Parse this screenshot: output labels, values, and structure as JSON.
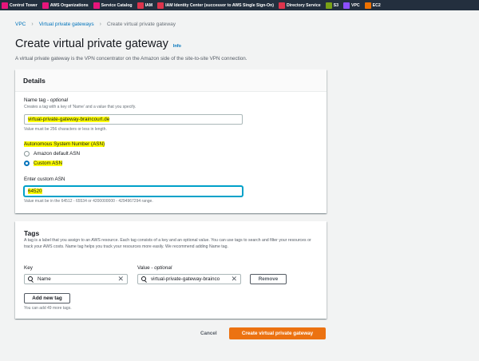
{
  "favorites": [
    {
      "label": "Control Tower",
      "color": "#e7157b",
      "icon": "control-tower-icon"
    },
    {
      "label": "AWS Organizations",
      "color": "#e7157b",
      "icon": "organizations-icon"
    },
    {
      "label": "Service Catalog",
      "color": "#e7157b",
      "icon": "service-catalog-icon"
    },
    {
      "label": "IAM",
      "color": "#dd344c",
      "icon": "iam-icon"
    },
    {
      "label": "IAM Identity Center (successor to AWS Single Sign-On)",
      "color": "#dd344c",
      "icon": "identity-center-icon"
    },
    {
      "label": "Directory Service",
      "color": "#dd344c",
      "icon": "directory-service-icon"
    },
    {
      "label": "S3",
      "color": "#7aa116",
      "icon": "s3-icon"
    },
    {
      "label": "VPC",
      "color": "#8c4fff",
      "icon": "vpc-icon"
    },
    {
      "label": "EC2",
      "color": "#ed7100",
      "icon": "ec2-icon"
    }
  ],
  "breadcrumb": {
    "vpc": "VPC",
    "vgw": "Virtual private gateways",
    "current": "Create virtual private gateway"
  },
  "page": {
    "title": "Create virtual private gateway",
    "info": "Info",
    "description": "A virtual private gateway is the VPN concentrator on the Amazon side of the site-to-site VPN connection."
  },
  "details": {
    "header": "Details",
    "name_tag_label": "Name tag - ",
    "name_tag_optional": "optional",
    "name_tag_hint": "Creates a tag with a key of 'Name' and a value that you specify.",
    "name_tag_value": "virtual-private-gateway-braincourt.de",
    "name_tag_constraint": "Value must be 256 characters or less in length.",
    "asn_label": "Autonomous System Number (ASN)",
    "asn_options": [
      "Amazon default ASN",
      "Custom ASN"
    ],
    "asn_selected": "Custom ASN",
    "custom_asn_label": "Enter custom ASN",
    "custom_asn_value": "64520",
    "custom_asn_constraint": "Value must be in the 64512 - 65534 or 4200000000 - 4294967294 range."
  },
  "tags": {
    "header": "Tags",
    "description": "A tag is a label that you assign to an AWS resource. Each tag consists of a key and an optional value. You can use tags to search and filter your resources or track your AWS costs. Name tag helps you track your resources more easily. We recommend adding Name tag.",
    "key_label": "Key",
    "value_label": "Value - ",
    "value_optional": "optional",
    "key_value": "Name",
    "value_value": "virtual-private-gateway-brainco",
    "remove_label": "Remove",
    "add_label": "Add new tag",
    "remaining": "You can add 49 more tags."
  },
  "footer": {
    "cancel": "Cancel",
    "submit": "Create virtual private gateway"
  },
  "colors": {
    "highlight": "#ffff00",
    "primary": "#ec7211",
    "link": "#0073bb",
    "topbar": "#232f3e"
  }
}
